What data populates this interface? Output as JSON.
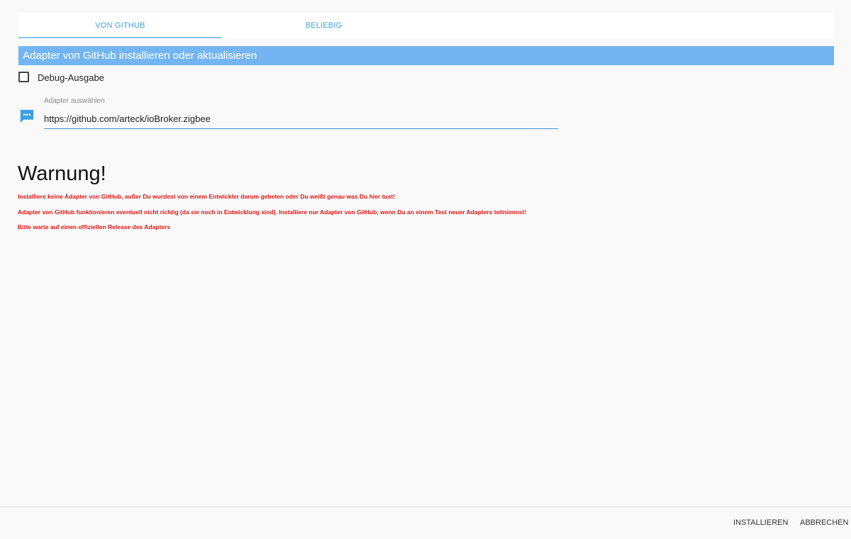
{
  "tabs": [
    {
      "label": "VON GITHUB",
      "active": true
    },
    {
      "label": "BELIEBIG",
      "active": false
    }
  ],
  "header": {
    "title": "Adapter von GitHub installieren oder aktualisieren"
  },
  "debug": {
    "label": "Debug-Ausgabe",
    "checked": false
  },
  "adapter_field": {
    "label": "Adapter auswählen",
    "value": "https://github.com/arteck/ioBroker.zigbee",
    "icon": "chat-bubble-dots-icon"
  },
  "warning": {
    "title": "Warnung!",
    "lines": [
      "Installiere keine Adapter von GitHub, außer Du wurdest von einem Entwickler darum gebeten oder Du weißt genau was Du hier tust!",
      "Adapter von GitHub funktionieren eventuell nicht richtig (da sie noch in Entwicklung sind). Installiere nur Adapter von GitHub, wenn Du an einem Test neuer Adapters teilnimmst!",
      "Bitte warte auf einen offiziellen Release des Adapters"
    ]
  },
  "footer": {
    "install_label": "INSTALLIEREN",
    "cancel_label": "ABBRECHEN"
  },
  "colors": {
    "accent": "#3d9fe6",
    "header_bg": "#72b5f2",
    "warning": "#e01414",
    "background": "#f9f9f9"
  }
}
